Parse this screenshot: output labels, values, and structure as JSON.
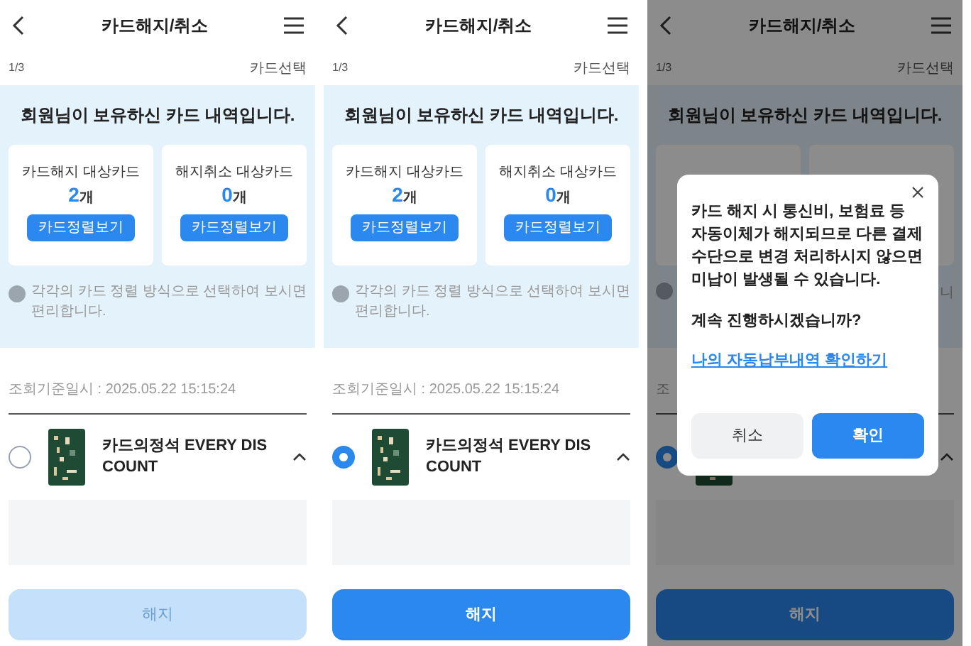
{
  "panels": [
    {
      "title": "카드해지/취소",
      "step": "1/3",
      "step_label": "카드선택",
      "headline": "회원님이 보유하신 카드 내역입니다.",
      "summary": [
        {
          "label": "카드해지 대상카드",
          "count": "2",
          "unit": "개",
          "button": "카드정렬보기"
        },
        {
          "label": "해지취소 대상카드",
          "count": "0",
          "unit": "개",
          "button": "카드정렬보기"
        }
      ],
      "info": "각각의 카드 정렬 방식으로 선택하여 보시면 편리합니다.",
      "timestamp": "조회기준일시 : 2025.05.22 15:15:24",
      "card": {
        "name": "카드의정석 EVERY DISCOUNT",
        "selected": false
      },
      "action": {
        "label": "해지",
        "disabled": true
      }
    },
    {
      "title": "카드해지/취소",
      "step": "1/3",
      "step_label": "카드선택",
      "headline": "회원님이 보유하신 카드 내역입니다.",
      "summary": [
        {
          "label": "카드해지 대상카드",
          "count": "2",
          "unit": "개",
          "button": "카드정렬보기"
        },
        {
          "label": "해지취소 대상카드",
          "count": "0",
          "unit": "개",
          "button": "카드정렬보기"
        }
      ],
      "info": "각각의 카드 정렬 방식으로 선택하여 보시면 편리합니다.",
      "timestamp": "조회기준일시 : 2025.05.22 15:15:24",
      "card": {
        "name": "카드의정석 EVERY DISCOUNT",
        "selected": true
      },
      "action": {
        "label": "해지",
        "disabled": false
      }
    },
    {
      "title": "카드해지/취소",
      "step": "1/3",
      "step_label": "카드선택",
      "headline": "회원님이 보유하신 카드 내역입니다.",
      "info_fragment": "니",
      "timestamp_fragment": "조",
      "card": {
        "selected": true
      },
      "action": {
        "label": "해지",
        "disabled": false
      },
      "modal": {
        "message": "카드 해지 시 통신비, 보험료 등 자동이체가 해지되므로 다른 결제 수단으로 변경 처리하시지 않으면 미납이 발생될 수 있습니다.",
        "question": "계속 진행하시겠습니까?",
        "link": "나의 자동납부내역 확인하기",
        "buttons": [
          {
            "label": "취소",
            "kind": "secondary"
          },
          {
            "label": "확인",
            "kind": "primary"
          }
        ]
      }
    }
  ]
}
